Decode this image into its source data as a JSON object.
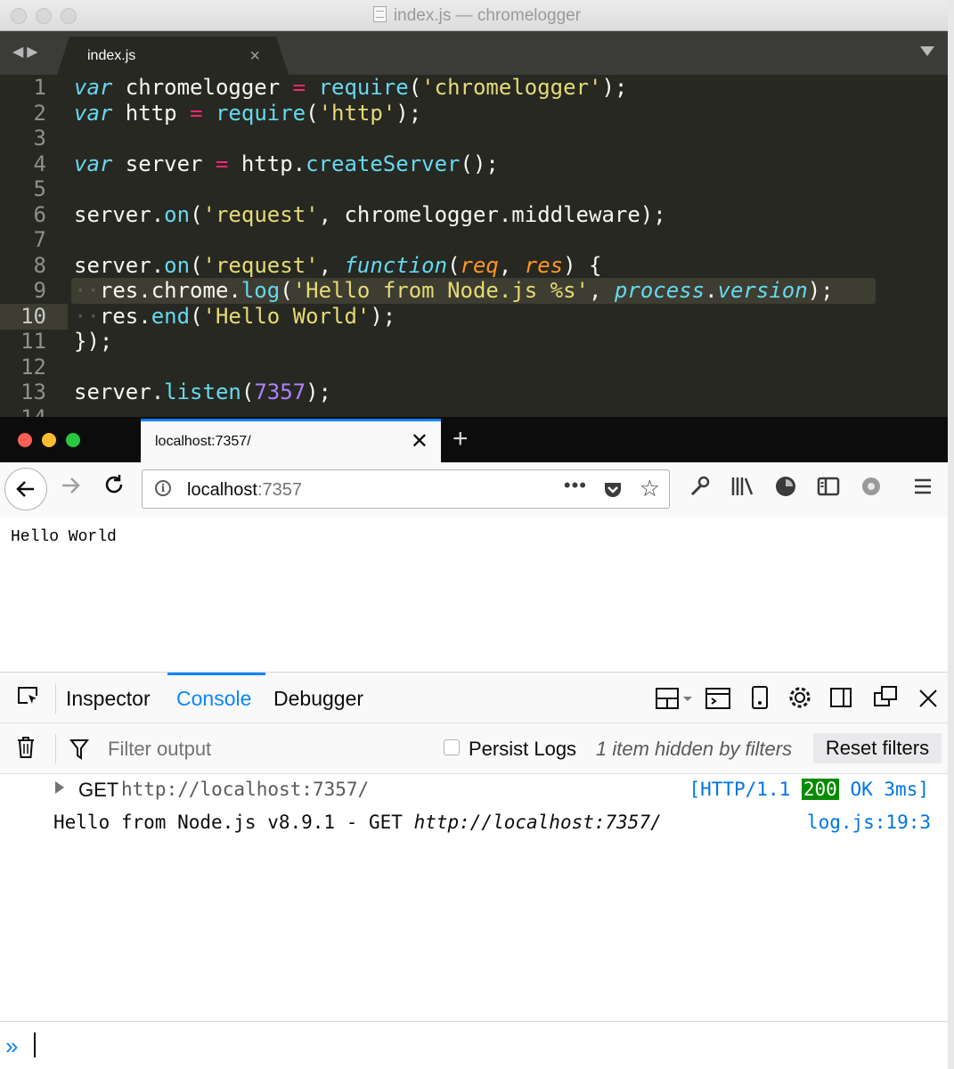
{
  "editor": {
    "window_title": "index.js — chromelogger",
    "tab_label": "index.js",
    "tab_close": "×",
    "line_numbers": [
      "1",
      "2",
      "3",
      "4",
      "5",
      "6",
      "7",
      "8",
      "9",
      "10",
      "11",
      "12",
      "13",
      "14"
    ]
  },
  "browser": {
    "tab_title": "localhost:7357/",
    "tab_close": "✕",
    "new_tab": "+",
    "url_host": "localhost",
    "url_port": ":7357",
    "page_text": "Hello World",
    "traffic_light_colors": [
      "#fe5f57",
      "#febc2e",
      "#28c840"
    ],
    "accent": "#0a84ff"
  },
  "devtools": {
    "tabs": [
      "Inspector",
      "Console",
      "Debugger"
    ],
    "active_tab": "Console",
    "filter_placeholder": "Filter output",
    "persist_logs": "Persist Logs",
    "hidden_note": "1 item hidden by filters",
    "reset_filters": "Reset filters",
    "messages": {
      "request": {
        "method": "GET",
        "url": "http://localhost:7357/",
        "proto": "[HTTP/1.1",
        "code": "200",
        "status": "OK 3ms]"
      },
      "log": {
        "text": "Hello from Node.js v8.9.1 - GET ",
        "url": "http://localhost:7357/",
        "location": "log.js:19:3"
      }
    }
  }
}
